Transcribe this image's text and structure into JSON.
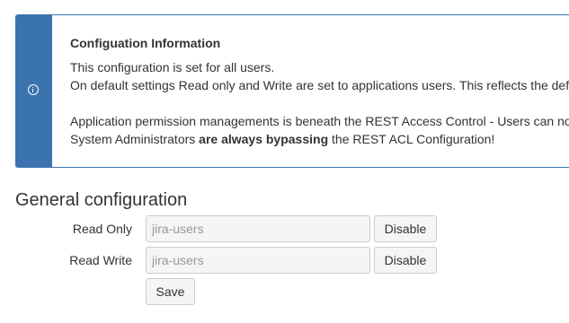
{
  "info": {
    "title": "Configuation Information",
    "line1": "This configuration is set for all users.",
    "line2": "On default settings Read only and Write are set to applications users. This reflects the def",
    "line3": "Application permission managements is beneath the REST Access Control - Users can no",
    "line4_prefix": "System Administrators ",
    "line4_bold": "are always bypassing",
    "line4_suffix": " the REST ACL Configuration!",
    "icon": "info-icon",
    "accent_color": "#3b73af"
  },
  "general": {
    "title": "General configuration",
    "read_only": {
      "label": "Read Only",
      "placeholder": "jira-users",
      "value": "",
      "button": "Disable"
    },
    "read_write": {
      "label": "Read Write",
      "placeholder": "jira-users",
      "value": "",
      "button": "Disable"
    },
    "save_label": "Save"
  }
}
